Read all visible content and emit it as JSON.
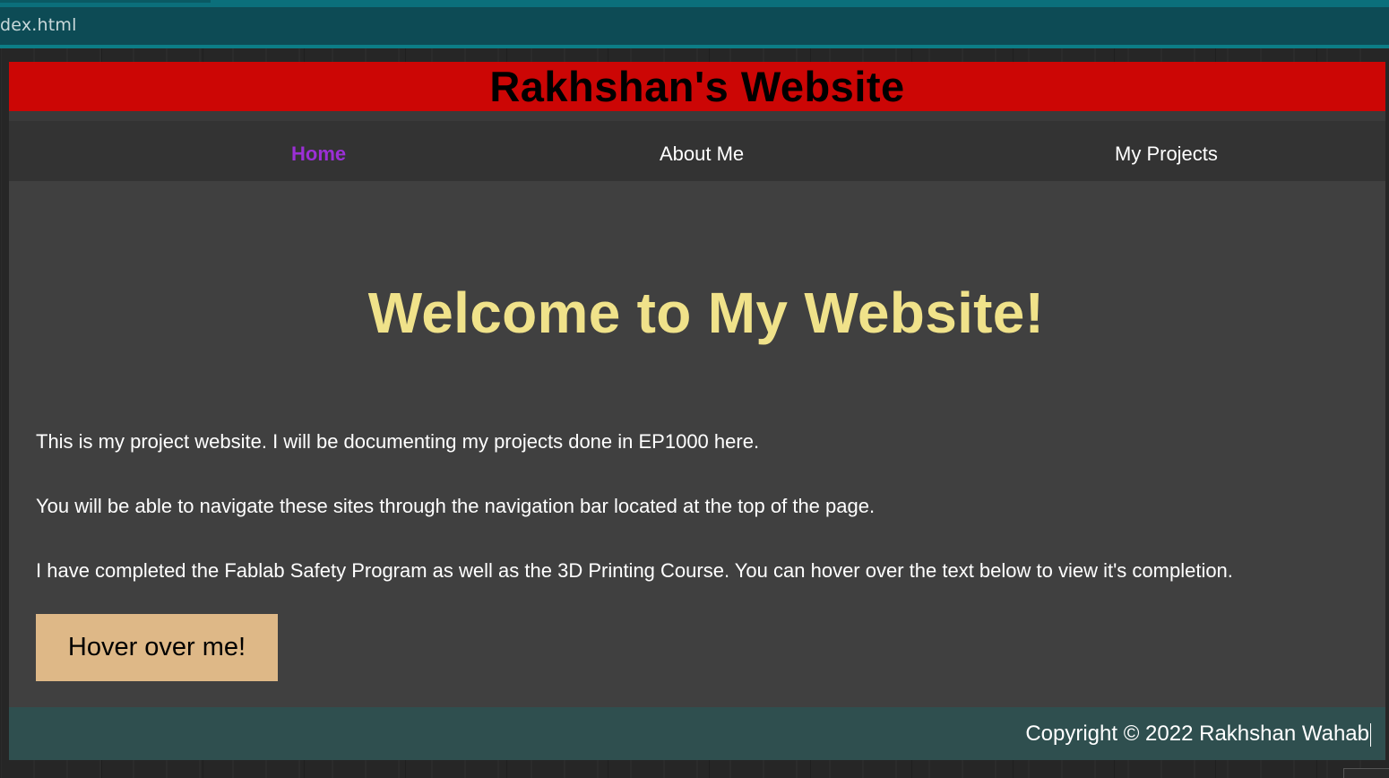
{
  "browser": {
    "address_text": "dex.html"
  },
  "header": {
    "title": "Rakhshan's Website"
  },
  "nav": {
    "items": [
      {
        "label": "Home",
        "active": true
      },
      {
        "label": "About Me",
        "active": false
      },
      {
        "label": "My Projects",
        "active": false
      }
    ]
  },
  "main": {
    "heading": "Welcome to My Website!",
    "paragraphs": [
      "This is my project website. I will be documenting my projects done in EP1000 here.",
      "You will be able to navigate these sites through the navigation bar located at the top of the page.",
      "I have completed the Fablab Safety Program as well as the 3D Printing Course. You can hover over the text below to view it's completion."
    ],
    "hover_button_label": "Hover over me!"
  },
  "footer": {
    "copyright": "Copyright © 2022 Rakhshan Wahab"
  },
  "colors": {
    "header_bg": "#cc0605",
    "nav_bg": "#333333",
    "nav_active": "#9b2fd6",
    "main_bg": "#404040",
    "heading": "#f0e28a",
    "button_bg": "#deb887",
    "footer_bg": "#2f4f4f"
  }
}
